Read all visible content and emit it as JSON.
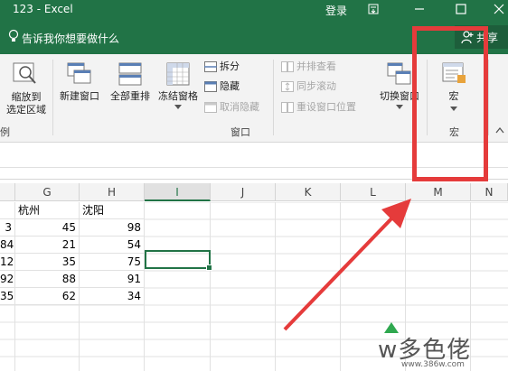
{
  "window": {
    "title": "123 - Excel",
    "login": "登录"
  },
  "tellme": {
    "text": "告诉我你想要做什么"
  },
  "share": {
    "label": "共享"
  },
  "ribbon": {
    "zoom_selection": {
      "line1": "缩放到",
      "line2": "选定区域"
    },
    "new_window": "新建窗口",
    "arrange_all": "全部重排",
    "freeze_panes": "冻结窗格",
    "split": "拆分",
    "hide": "隐藏",
    "unhide": "取消隐藏",
    "view_side_by_side": "并排查看",
    "sync_scroll": "同步滚动",
    "reset_position": "重设窗口位置",
    "switch_windows": "切换窗口",
    "macros": "宏",
    "group_left_partial": "例",
    "group_window": "窗口",
    "group_macros": "宏"
  },
  "columns": [
    "G",
    "H",
    "I",
    "J",
    "K",
    "L",
    "M",
    "N"
  ],
  "selected_column": "I",
  "table": {
    "header": [
      "",
      "杭州",
      "沈阳"
    ],
    "rows": [
      [
        "3",
        "45",
        "98"
      ],
      [
        "84",
        "21",
        "54"
      ],
      [
        "12",
        "35",
        "75"
      ],
      [
        "92",
        "88",
        "91"
      ],
      [
        "35",
        "62",
        "34"
      ]
    ]
  },
  "watermark": {
    "brand": "w多色佬",
    "url": "www.386w.com"
  },
  "colors": {
    "excel_green": "#217346",
    "highlight_red": "#e53b3b"
  }
}
